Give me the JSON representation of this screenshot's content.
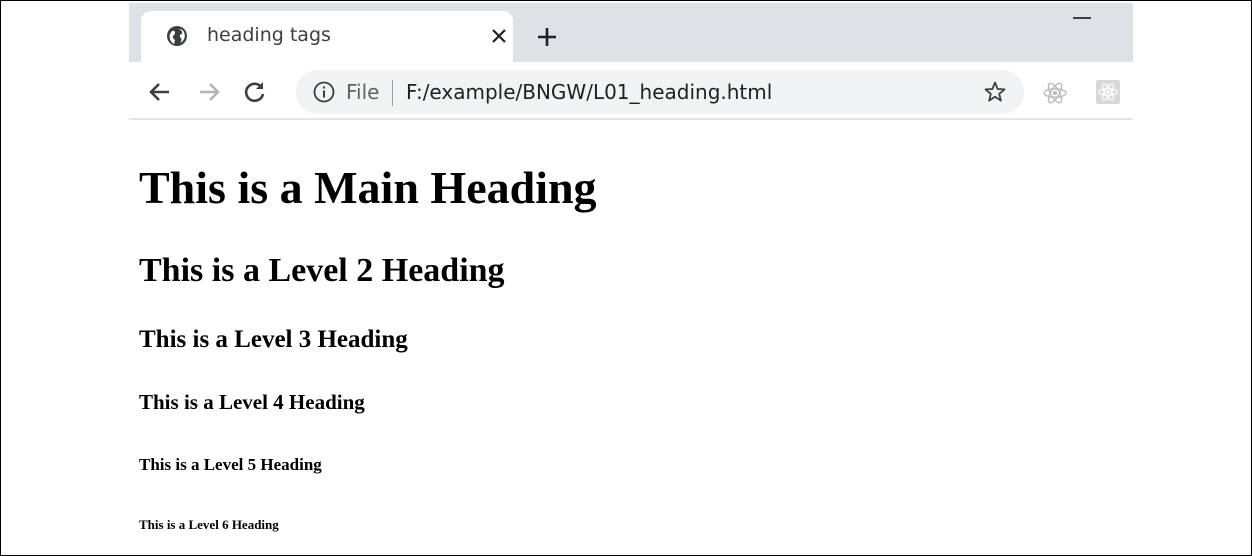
{
  "browser": {
    "tab": {
      "title": "heading tags",
      "favicon": "globe-icon"
    },
    "toolbar": {
      "scheme_label": "File",
      "url": "F:/example/BNGW/L01_heading.html"
    },
    "icons": {
      "back": "arrow-left-icon",
      "forward": "arrow-right-icon",
      "reload": "reload-icon",
      "info": "info-icon",
      "bookmark": "star-icon",
      "new_tab": "plus-icon",
      "close_tab": "close-icon",
      "minimize": "minimize-icon",
      "extension_1": "react-icon",
      "extension_2": "extension-icon"
    },
    "colors": {
      "tabstrip": "#dee1e6",
      "omnibox": "#f1f3f4",
      "text": "#202124"
    }
  },
  "page": {
    "headings": {
      "h1": "This is a Main Heading",
      "h2": "This is a Level 2 Heading",
      "h3": "This is a Level 3 Heading",
      "h4": "This is a Level 4 Heading",
      "h5": "This is a Level 5 Heading",
      "h6": "This is a Level 6 Heading"
    }
  }
}
